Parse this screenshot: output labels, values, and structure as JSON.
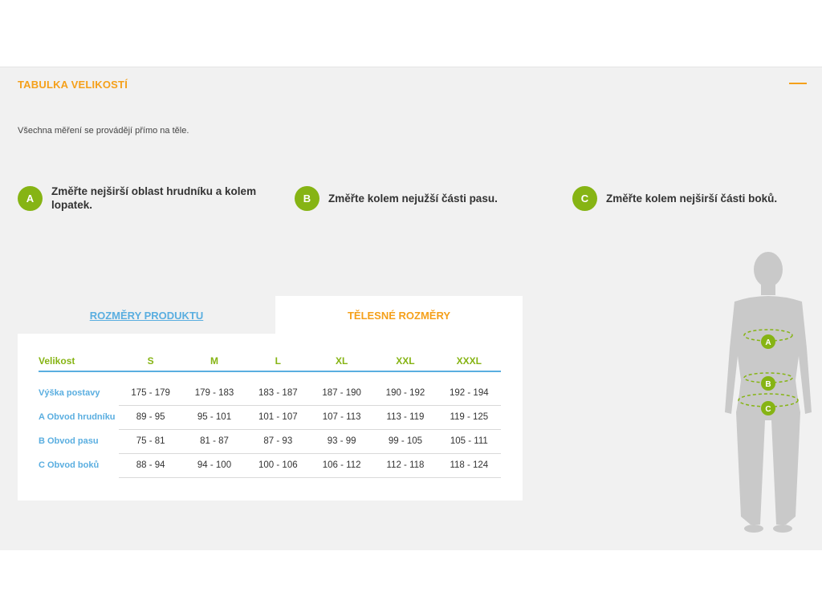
{
  "header": {
    "title": "TABULKA VELIKOSTÍ"
  },
  "intro": "Všechna měření se provádějí přímo na těle.",
  "steps": [
    {
      "letter": "A",
      "text": "Změřte nejširší oblast hrudníku a kolem lopatek."
    },
    {
      "letter": "B",
      "text": "Změřte kolem nejužší části pasu."
    },
    {
      "letter": "C",
      "text": "Změřte kolem nejširší části boků."
    }
  ],
  "tabs": {
    "product": "ROZMĚRY PRODUKTU",
    "body": "TĚLESNÉ ROZMĚRY"
  },
  "table": {
    "header": [
      "Velikost",
      "S",
      "M",
      "L",
      "XL",
      "XXL",
      "XXXL"
    ],
    "rows": [
      [
        "Výška postavy",
        "175 - 179",
        "179 - 183",
        "183 - 187",
        "187 - 190",
        "190 - 192",
        "192 - 194"
      ],
      [
        "A Obvod hrudníku",
        "89 - 95",
        "95 - 101",
        "101 - 107",
        "107 - 113",
        "113 - 119",
        "119 - 125"
      ],
      [
        "B Obvod pasu",
        "75 - 81",
        "81 - 87",
        "87 - 93",
        "93 - 99",
        "99 - 105",
        "105 - 111"
      ],
      [
        "C Obvod boků",
        "88 - 94",
        "94 - 100",
        "100 - 106",
        "106 - 112",
        "112 - 118",
        "118 - 124"
      ]
    ]
  },
  "figure": {
    "labels": [
      "A",
      "B",
      "C"
    ]
  },
  "colors": {
    "accent": "#f5a01a",
    "green": "#86b414",
    "blue": "#5aaee0",
    "panel": "#f1f1f1"
  }
}
